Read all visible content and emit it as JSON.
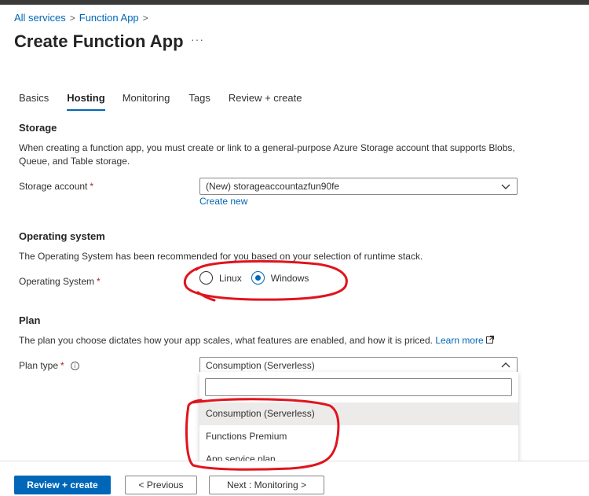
{
  "breadcrumb": {
    "items": [
      "All services",
      "Function App"
    ],
    "separator": ">"
  },
  "page": {
    "title": "Create Function App",
    "more": "···"
  },
  "tabs": [
    {
      "label": "Basics"
    },
    {
      "label": "Hosting",
      "active": true
    },
    {
      "label": "Monitoring"
    },
    {
      "label": "Tags"
    },
    {
      "label": "Review + create"
    }
  ],
  "storage": {
    "heading": "Storage",
    "description": "When creating a function app, you must create or link to a general-purpose Azure Storage account that supports Blobs, Queue, and Table storage.",
    "account_label": "Storage account",
    "account_value": "(New) storageaccountazfun90fe",
    "create_new": "Create new"
  },
  "os": {
    "heading": "Operating system",
    "description": "The Operating System has been recommended for you based on your selection of runtime stack.",
    "label": "Operating System",
    "options": [
      {
        "label": "Linux",
        "selected": false
      },
      {
        "label": "Windows",
        "selected": true
      }
    ]
  },
  "plan": {
    "heading": "Plan",
    "description": "The plan you choose dictates how your app scales, what features are enabled, and how it is priced.",
    "learn_more": "Learn more",
    "type_label": "Plan type",
    "type_value": "Consumption (Serverless)",
    "search_value": "",
    "options": [
      {
        "label": "Consumption (Serverless)",
        "highlighted": true
      },
      {
        "label": "Functions Premium",
        "highlighted": false
      },
      {
        "label": "App service plan",
        "highlighted": false
      }
    ]
  },
  "footer": {
    "review_create": "Review + create",
    "previous": "< Previous",
    "next": "Next : Monitoring >"
  },
  "colors": {
    "accent": "#0067b8",
    "annotation": "#e0141e",
    "required": "#a4262c"
  },
  "icons": {
    "chevron_down": "chevron-down-icon",
    "chevron_up": "chevron-up-icon",
    "info": "info-icon",
    "external": "external-link-icon",
    "more": "more-icon"
  }
}
